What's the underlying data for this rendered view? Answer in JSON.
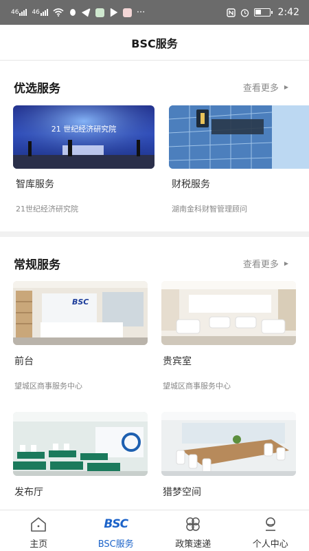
{
  "status_bar": {
    "signal_1": "46",
    "signal_2": "46",
    "more": "···",
    "time": "2:42"
  },
  "header": {
    "title": "BSC服务"
  },
  "featured": {
    "title": "优选服务",
    "more": "查看更多",
    "cards": [
      {
        "name": "智库服务",
        "sub": "21世纪经济研究院",
        "img_text": "21 世纪经济研究院"
      },
      {
        "name": "财税服务",
        "sub": "湖南金科财智管理顾问"
      }
    ]
  },
  "regular": {
    "title": "常规服务",
    "more": "查看更多",
    "cards": [
      {
        "name": "前台",
        "sub": "望城区商事服务中心",
        "img_text": "BSC"
      },
      {
        "name": "贵宾室",
        "sub": "望城区商事服务中心"
      },
      {
        "name": "发布厅"
      },
      {
        "name": "猎梦空间"
      }
    ]
  },
  "tabbar": {
    "items": [
      {
        "label": "主页",
        "icon": "home-icon"
      },
      {
        "label": "BSC服务",
        "icon": "bsc-logo-icon",
        "logo_text": "BSC"
      },
      {
        "label": "政策速递",
        "icon": "clover-icon"
      },
      {
        "label": "个人中心",
        "icon": "person-icon"
      }
    ],
    "active_color": "#1c63c9"
  }
}
